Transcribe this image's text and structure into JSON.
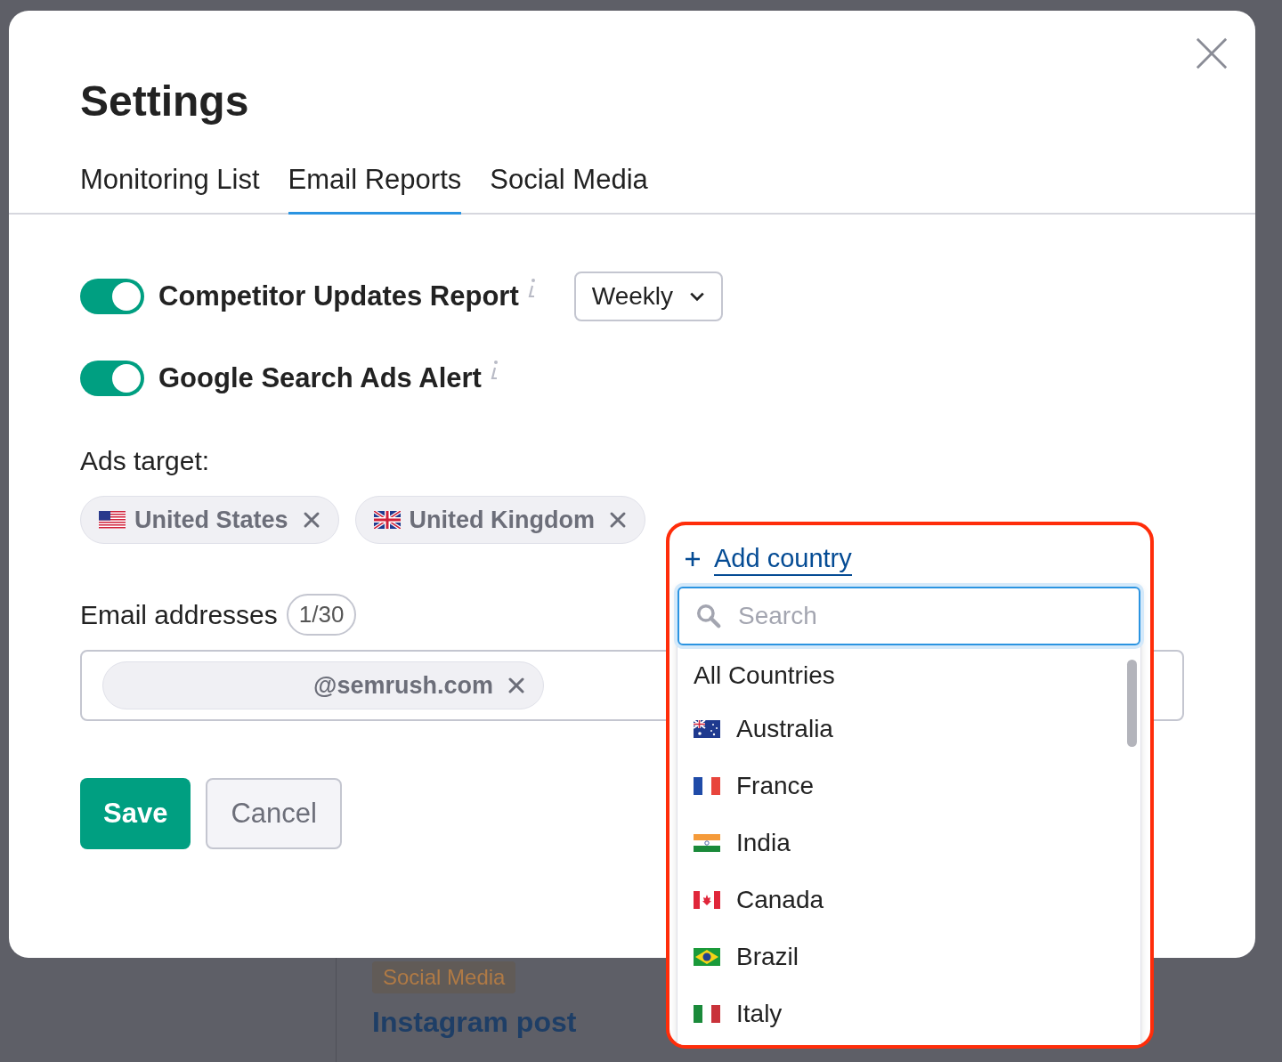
{
  "background": {
    "tag": "Social Media",
    "post_title": "Instagram post"
  },
  "dialog": {
    "title": "Settings"
  },
  "tabs": [
    {
      "label": "Monitoring List",
      "selected": false
    },
    {
      "label": "Email Reports",
      "selected": true
    },
    {
      "label": "Social Media",
      "selected": false
    }
  ],
  "reports": [
    {
      "label": "Competitor Updates Report",
      "on": true,
      "frequency": "Weekly"
    },
    {
      "label": "Google Search Ads Alert",
      "on": true
    }
  ],
  "ads_target": {
    "label": "Ads target:",
    "countries": [
      {
        "name": "United States",
        "kind": "us"
      },
      {
        "name": "United Kingdom",
        "kind": "gb"
      }
    ]
  },
  "email": {
    "label": "Email addresses",
    "count": "1/30",
    "addresses": [
      "@semrush.com"
    ]
  },
  "buttons": [
    {
      "label": "Save",
      "kind": "primary"
    },
    {
      "label": "Cancel",
      "kind": "secondary"
    }
  ],
  "country_picker": {
    "add_label": "Add country",
    "search": {
      "placeholder": "Search"
    },
    "options": [
      {
        "name": "All Countries",
        "kind": "all"
      },
      {
        "name": "Australia",
        "kind": "au"
      },
      {
        "name": "France",
        "kind": "fr"
      },
      {
        "name": "India",
        "kind": "in"
      },
      {
        "name": "Canada",
        "kind": "ca"
      },
      {
        "name": "Brazil",
        "kind": "br"
      },
      {
        "name": "Italy",
        "kind": "it"
      }
    ]
  }
}
